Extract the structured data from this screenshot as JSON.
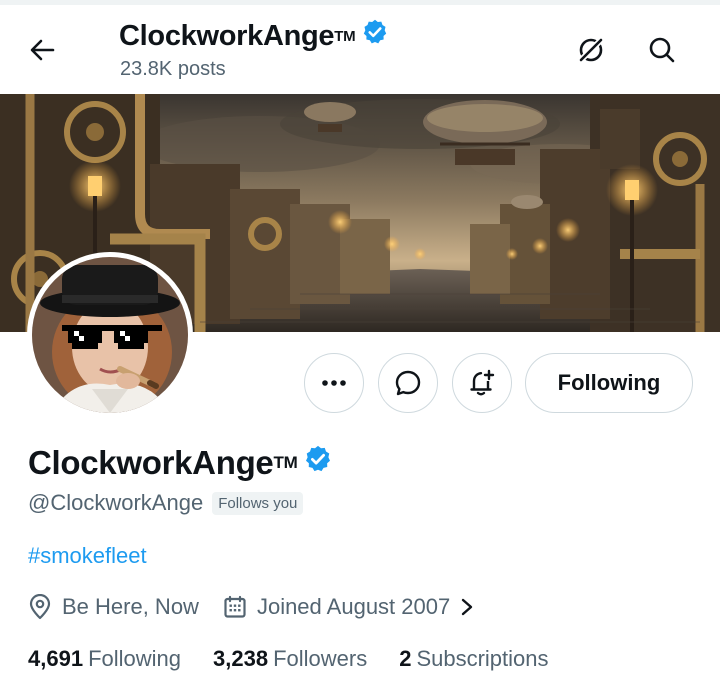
{
  "header": {
    "name": "ClockworkAnge",
    "trademark": "TM",
    "posts": "23.8K posts",
    "icons": [
      "back-arrow-icon",
      "grok-icon",
      "search-icon"
    ]
  },
  "profile": {
    "name": "ClockworkAnge",
    "trademark": "TM",
    "handle": "@ClockworkAnge",
    "follows_you": "Follows you",
    "bio": "#smokefleet",
    "location": "Be Here, Now",
    "joined": "Joined August 2007",
    "stats": {
      "following_count": "4,691",
      "following_label": "Following",
      "followers_count": "3,238",
      "followers_label": "Followers",
      "subscriptions_count": "2",
      "subscriptions_label": "Subscriptions"
    }
  },
  "actions": {
    "following_label": "Following",
    "icons": [
      "more-icon",
      "message-icon",
      "notification-bell-icon"
    ]
  },
  "colors": {
    "accent": "#1d9bf0",
    "text_primary": "#0f1419",
    "text_secondary": "#536471",
    "border": "#cfd9de",
    "badge_bg": "#eff3f4"
  }
}
